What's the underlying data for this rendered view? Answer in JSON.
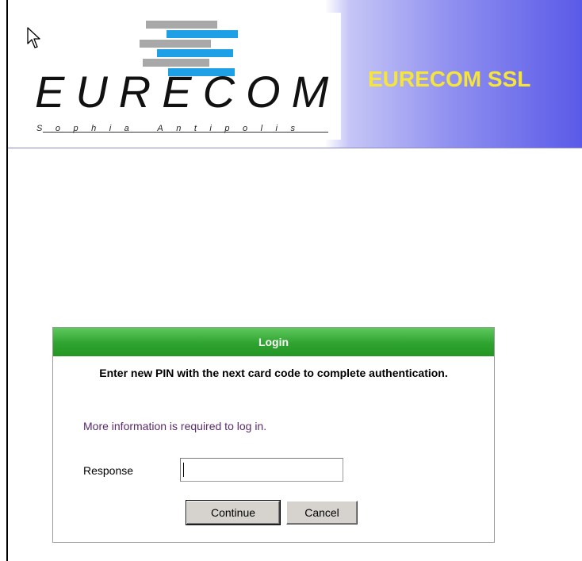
{
  "header": {
    "logo_text": "EURECOM",
    "logo_subtext": "Sophia Antipolis",
    "title": "EURECOM SSL",
    "title_color": "#f5e53a",
    "gradient_color": "#5a5ae8"
  },
  "login": {
    "heading": "Login",
    "header_color": "#2fa32f",
    "message": "Enter new PIN with the next card code to complete authentication.",
    "info": "More information is required to log in.",
    "response_label": "Response",
    "response_value": "",
    "continue_label": "Continue",
    "cancel_label": "Cancel"
  }
}
